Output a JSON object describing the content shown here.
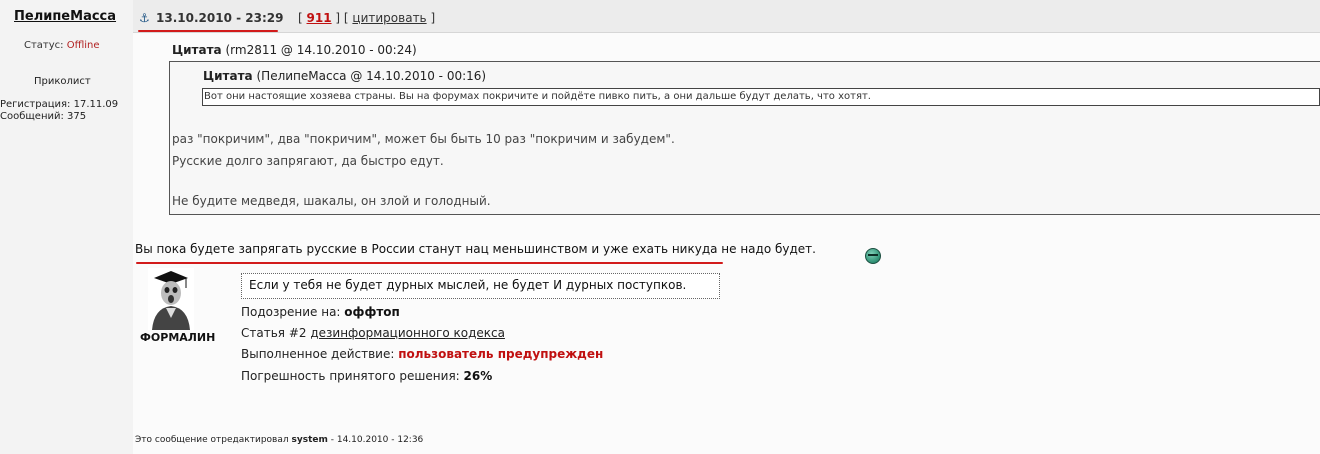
{
  "sidebar": {
    "username": "ПелипеМасса",
    "status_label": "Статус:",
    "status_value": "Offline",
    "rank": "Приколист",
    "registration": "Регистрация: 17.11.09",
    "messages": "Сообщений: 375"
  },
  "post_header": {
    "anchor_icon": "anchor-icon",
    "date": "13.10.2010 - 23:29",
    "bracket_open": "[",
    "post_id": "911",
    "bracket_mid": "] [",
    "quote_label": "цитировать",
    "bracket_close": "]"
  },
  "outer_quote": {
    "title_word": "Цитата",
    "title_rest": "(rm2811 @ 14.10.2010 - 00:24)",
    "line1": "раз \"покричим\", два \"покричим\", может бы быть 10 раз \"покричим и забудем\".",
    "line2": "Русские долго запрягают, да быстро едут.",
    "line3": "Не будите медведя, шакалы, он злой и голодный."
  },
  "inner_quote": {
    "title_word": "Цитата",
    "title_rest": "(ПелипеМасса @ 14.10.2010 - 00:16)",
    "text": "Вот они настоящие хозяева страны. Вы на форумах покричите и пойдёте пивко пить, а они дальше будут делать, что хотят."
  },
  "body_text": "Вы пока будете запрягать русские в России станут нац меньшинством и уже ехать никуда не надо будет.",
  "smiley_icon": "smiley-icon",
  "moderator": {
    "avatar_icon": "graduate-avatar-icon",
    "name": "ФОРМАЛИН",
    "quote": "Если у тебя не будет дурных мыслей, не будет И дурных поступков.",
    "suspicion_label": "Подозрение на:",
    "suspicion_value": "оффтоп",
    "article_label": "Статья #2",
    "article_link": "дезинформационного кодекса",
    "action_label": "Выполненное действие:",
    "action_value": "пользователь предупрежден",
    "error_label": "Погрешность принятого решения:",
    "error_value": "26%"
  },
  "edit_note": {
    "prefix": "Это сообщение отредактировал",
    "editor": "system",
    "date": "- 14.10.2010 - 12:36"
  },
  "colors": {
    "accent_red": "#d21b1b",
    "link_red": "#c01010",
    "anchor_blue": "#2a5d8a"
  }
}
